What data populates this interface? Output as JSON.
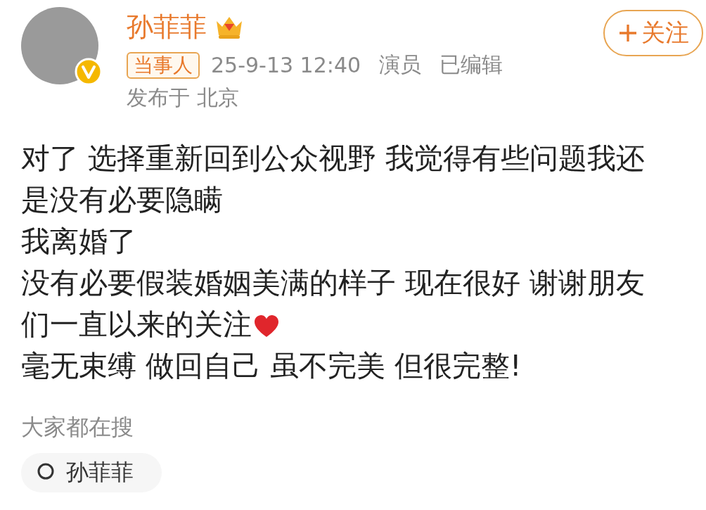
{
  "post": {
    "author": "孙菲菲",
    "verified": true,
    "follow_button": "关注",
    "tag": "当事人",
    "time": "25-9-13 12:40",
    "role": "演员",
    "edited": "已编辑",
    "location": "发布于 北京",
    "paragraphs": [
      {
        "text": "对了 选择重新回到公众视野 我觉得有些问题我还",
        "heart": false
      },
      {
        "text": "是没有必要隐瞒",
        "heart": false
      },
      {
        "text": "我离婚了",
        "heart": false
      },
      {
        "text": "没有必要假装婚姻美满的样子 现在很好 谢谢朋友",
        "heart": false
      },
      {
        "text": "们一直以来的关注",
        "heart": true
      },
      {
        "text": "毫无束缚 做回自己 虽不完美 但很完整!",
        "heart": false
      }
    ]
  },
  "trending": {
    "title": "大家都在搜",
    "items": [
      "孙菲菲"
    ]
  }
}
